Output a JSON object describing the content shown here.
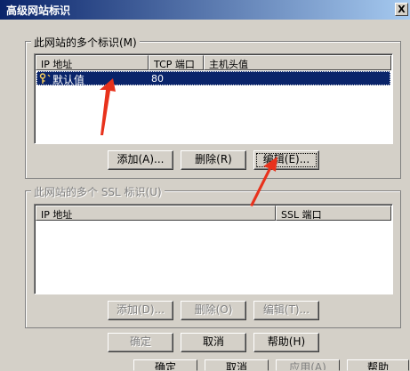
{
  "dialog": {
    "title": "高级网站标识",
    "close_label": "X"
  },
  "identities_group": {
    "legend": "此网站的多个标识(M)",
    "columns": [
      "IP 地址",
      "TCP 端口",
      "主机头值"
    ],
    "rows": [
      {
        "ip": "默认值",
        "port": "80",
        "host": ""
      }
    ],
    "buttons": {
      "add": "添加(A)...",
      "remove": "删除(R)",
      "edit": "编辑(E)..."
    }
  },
  "ssl_group": {
    "legend": "此网站的多个 SSL 标识(U)",
    "columns": [
      "IP 地址",
      "SSL 端口"
    ],
    "buttons": {
      "add": "添加(D)...",
      "remove": "删除(O)",
      "edit": "编辑(T)..."
    }
  },
  "footer": {
    "ok": "确定",
    "cancel": "取消",
    "help": "帮助(H)"
  },
  "behind_window": {
    "buttons": [
      "确定",
      "取消",
      "应用(A)",
      "帮助"
    ]
  },
  "colors": {
    "selection": "#0a246a",
    "annotation_arrow": "#e8321c",
    "face": "#d4d0c8"
  }
}
